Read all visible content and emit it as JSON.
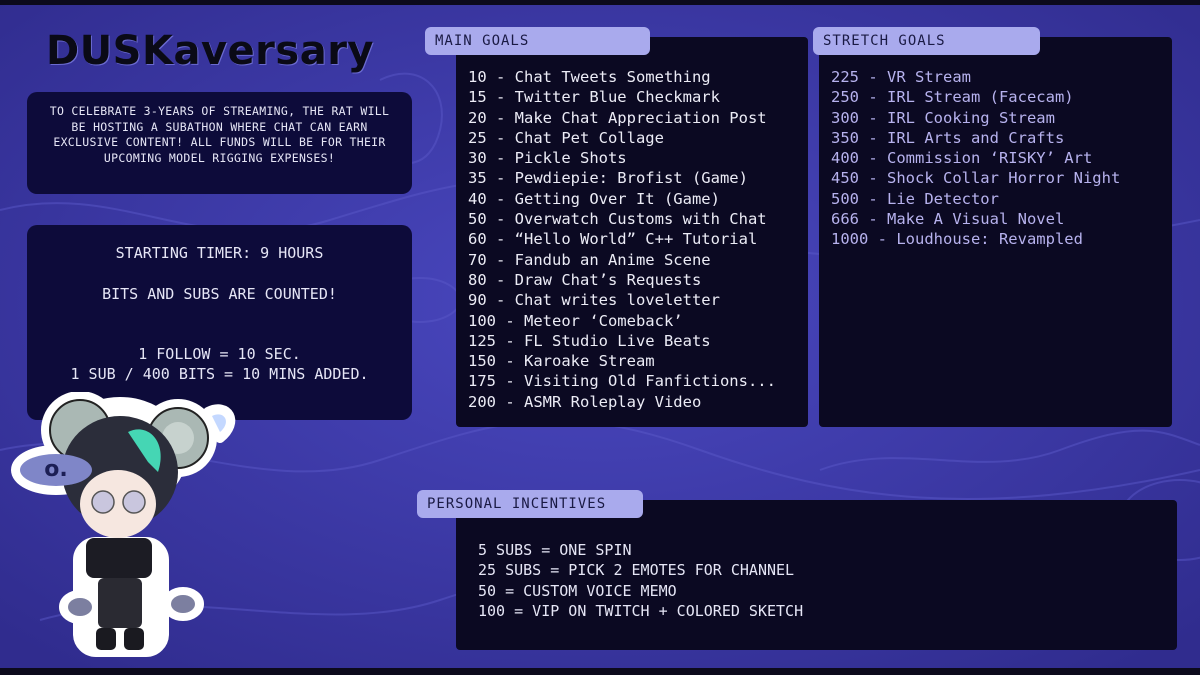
{
  "title": "DUSKaversary",
  "intro": {
    "text": "To celebrate 3-years of streaming, the rat will be hosting a subathon where chat can earn exclusive content! All funds will be for their upcoming model rigging expenses!"
  },
  "timer": {
    "line1": "Starting Timer: 9 Hours",
    "line2": "Bits and subs are counted!",
    "line3": "1 Follow = 10 Sec.",
    "line4": "1 Sub / 400 Bits = 10 Mins Added."
  },
  "main_goals": {
    "label": "Main Goals",
    "items": [
      "10 - Chat Tweets Something",
      "15 - Twitter Blue Checkmark",
      "20 - Make Chat Appreciation Post",
      "25 - Chat Pet Collage",
      "30 - Pickle Shots",
      "35 - Pewdiepie: Brofist (Game)",
      "40 - Getting Over It (Game)",
      "50 - Overwatch Customs with Chat",
      "60 - “Hello World” C++ Tutorial",
      "70 - Fandub an Anime Scene",
      "80 - Draw Chat’s Requests",
      "90 - Chat writes loveletter",
      "100 - Meteor ‘Comeback’",
      "125 - FL Studio Live Beats",
      "150 - Karoake Stream",
      "175 - Visiting Old Fanfictions...",
      "200 - ASMR Roleplay Video"
    ]
  },
  "stretch_goals": {
    "label": "Stretch Goals",
    "items": [
      "225 - VR Stream",
      "250 - IRL Stream (Facecam)",
      "300 - IRL Cooking Stream",
      "350 - IRL Arts and Crafts",
      "400 - Commission ‘RISKY’ Art",
      "450 - Shock Collar Horror Night",
      "500 - Lie Detector",
      "666 - Make A Visual Novel",
      "1000 - Loudhouse: Revampled"
    ]
  },
  "personal_incentives": {
    "label": "Personal Incentives",
    "items": [
      "5 Subs = One Spin",
      "25 Subs = Pick 2 Emotes for Channel",
      "50 = Custom Voice Memo",
      "100 = VIP on Twitch + Colored Sketch"
    ]
  },
  "colors": {
    "background": "#3b37a8",
    "panel": "#0d0b3a",
    "tab": "#a9aaed",
    "stretch_text": "#b7b2ee"
  },
  "icons": [
    "mascot-character-illustration"
  ]
}
